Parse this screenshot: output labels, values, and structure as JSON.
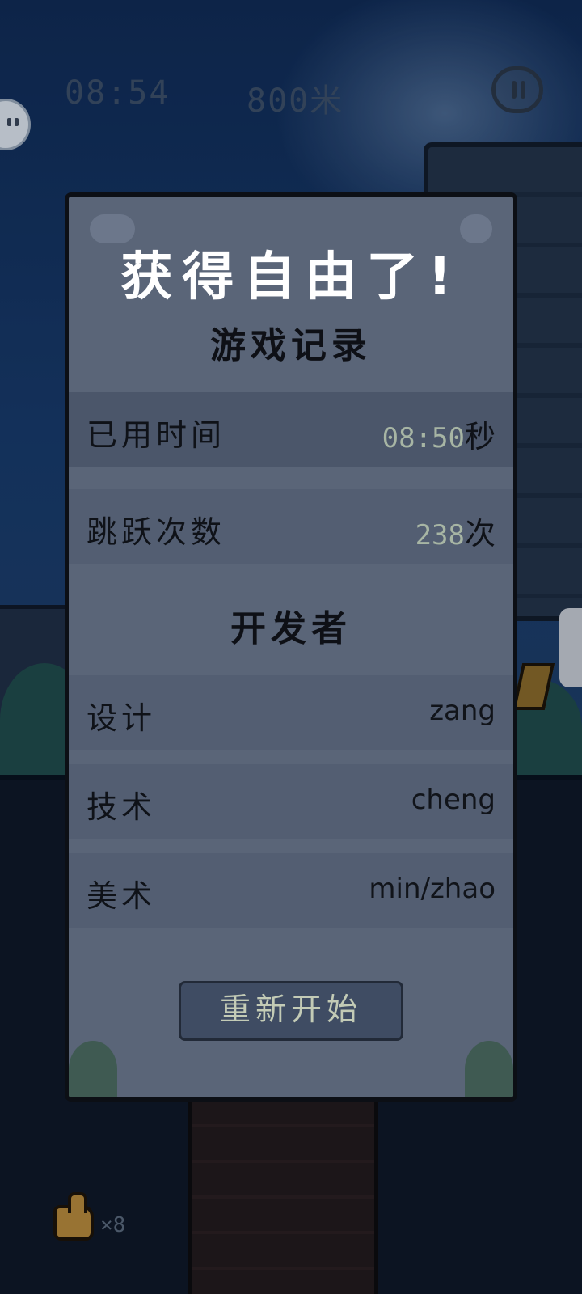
{
  "hud": {
    "time": "08:54",
    "distance": "800米"
  },
  "modal": {
    "title": "获得自由了!",
    "records_heading": "游戏记录",
    "records": [
      {
        "label": "已用时间",
        "value": "08:50",
        "unit": "秒"
      },
      {
        "label": "跳跃次数",
        "value": "238",
        "unit": "次"
      }
    ],
    "developers_heading": "开发者",
    "developers": [
      {
        "label": "设计",
        "value": "zang"
      },
      {
        "label": "技术",
        "value": "cheng"
      },
      {
        "label": "美术",
        "value": "min/zhao"
      }
    ],
    "restart_label": "重新开始"
  },
  "collectible": {
    "count": "×8",
    "icon": "thumbs-up-icon"
  }
}
